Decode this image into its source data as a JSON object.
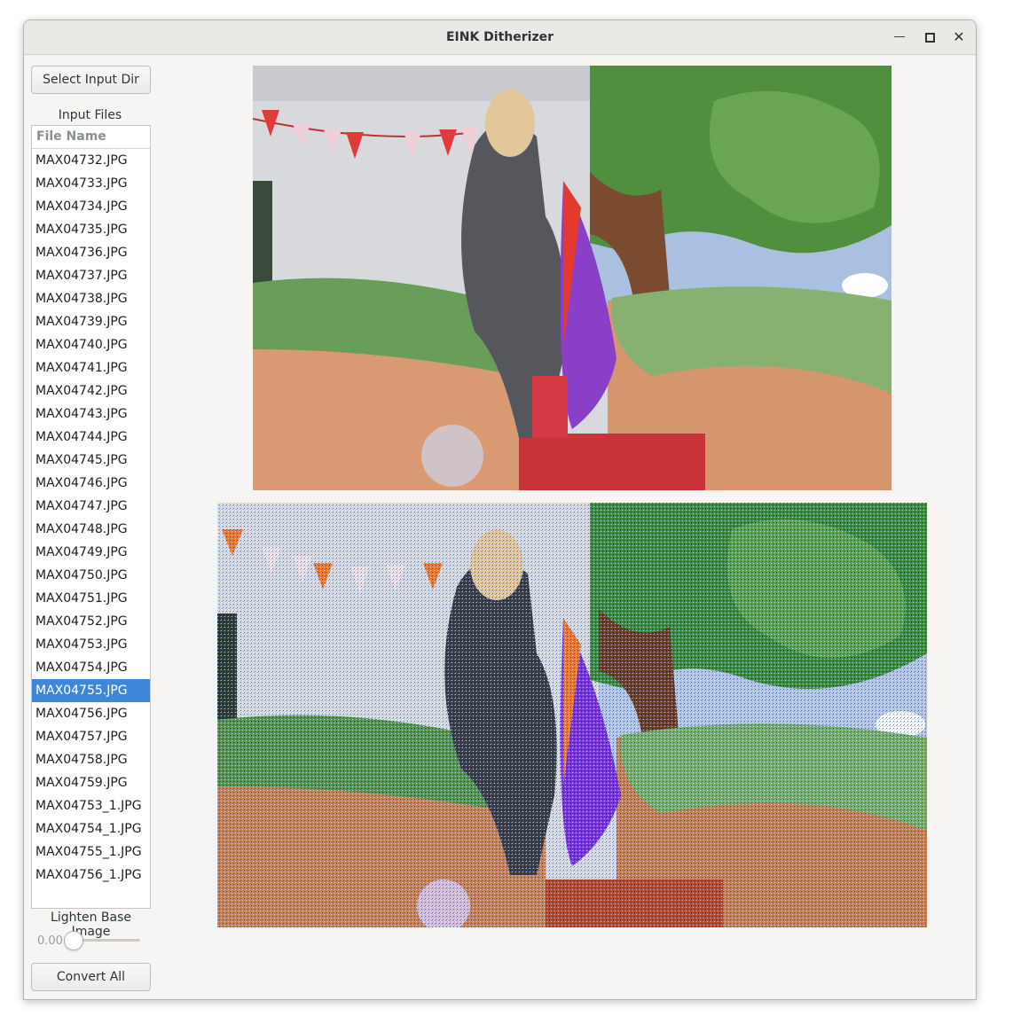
{
  "window": {
    "title": "EINK Ditherizer"
  },
  "controls": {
    "select_input_label": "Select Input Dir",
    "input_files_label": "Input Files",
    "column_header": "File Name",
    "lighten_label": "Lighten Base Image",
    "lighten_value": "0.00",
    "lighten_fraction": 0.0,
    "convert_label": "Convert All"
  },
  "files": [
    "MAX04732.JPG",
    "MAX04733.JPG",
    "MAX04734.JPG",
    "MAX04735.JPG",
    "MAX04736.JPG",
    "MAX04737.JPG",
    "MAX04738.JPG",
    "MAX04739.JPG",
    "MAX04740.JPG",
    "MAX04741.JPG",
    "MAX04742.JPG",
    "MAX04743.JPG",
    "MAX04744.JPG",
    "MAX04745.JPG",
    "MAX04746.JPG",
    "MAX04747.JPG",
    "MAX04748.JPG",
    "MAX04749.JPG",
    "MAX04750.JPG",
    "MAX04751.JPG",
    "MAX04752.JPG",
    "MAX04753.JPG",
    "MAX04754.JPG",
    "MAX04755.JPG",
    "MAX04756.JPG",
    "MAX04757.JPG",
    "MAX04758.JPG",
    "MAX04759.JPG",
    "MAX04753_1.JPG",
    "MAX04754_1.JPG",
    "MAX04755_1.JPG",
    "MAX04756_1.JPG"
  ],
  "selected_file": "MAX04755.JPG",
  "colors": {
    "selection": "#3d86d8",
    "window_bg": "#f6f5f4"
  }
}
